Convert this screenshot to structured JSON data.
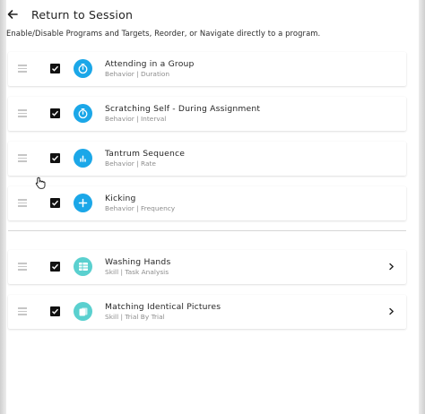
{
  "header": {
    "title": "Return to Session"
  },
  "subtitle": "Enable/Disable Programs and Targets, Reorder, or Navigate directly to a program.",
  "behaviors": [
    {
      "title": "Attending in a Group",
      "subtitle": "Behavior | Duration",
      "checked": true,
      "icon": "stopwatch-icon"
    },
    {
      "title": "Scratching Self - During Assignment",
      "subtitle": "Behavior | Interval",
      "checked": true,
      "icon": "stopwatch-icon"
    },
    {
      "title": "Tantrum Sequence",
      "subtitle": "Behavior | Rate",
      "checked": true,
      "icon": "bar-chart-icon"
    },
    {
      "title": "Kicking",
      "subtitle": "Behavior | Frequency",
      "checked": true,
      "icon": "plus-icon"
    }
  ],
  "skills": [
    {
      "title": "Washing Hands",
      "subtitle": "Skill | Task Analysis",
      "checked": true,
      "icon": "task-grid-icon"
    },
    {
      "title": "Matching Identical Pictures",
      "subtitle": "Skill | Trial By Trial",
      "checked": true,
      "icon": "cards-icon"
    }
  ],
  "colors": {
    "behavior_icon": "#1ba7e8",
    "skill_icon": "#5ad0cf",
    "checkbox": "#111111"
  }
}
